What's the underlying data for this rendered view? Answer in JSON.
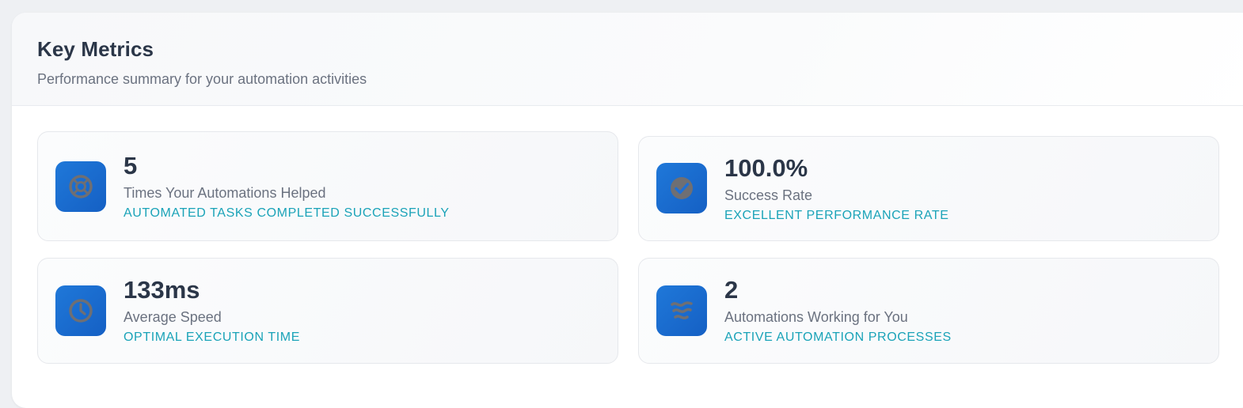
{
  "header": {
    "title": "Key Metrics",
    "subtitle": "Performance summary for your automation activities"
  },
  "metrics": [
    {
      "value": "5",
      "label": "Times Your Automations Helped",
      "note": "AUTOMATED TASKS COMPLETED SUCCESSFULLY",
      "icon": "lifebuoy-icon"
    },
    {
      "value": "100.0%",
      "label": "Success Rate",
      "note": "EXCELLENT PERFORMANCE RATE",
      "icon": "check-circle-icon"
    },
    {
      "value": "133ms",
      "label": "Average Speed",
      "note": "OPTIMAL EXECUTION TIME",
      "icon": "clock-icon"
    },
    {
      "value": "2",
      "label": "Automations Working for You",
      "note": "ACTIVE AUTOMATION PROCESSES",
      "icon": "wave-icon"
    }
  ],
  "colors": {
    "icon_bg": "#1f6fd4",
    "icon_glyph": "#6f6f73",
    "accent_text": "#1aa3b8",
    "value_text": "#2b3648",
    "muted_text": "#6b7280"
  }
}
